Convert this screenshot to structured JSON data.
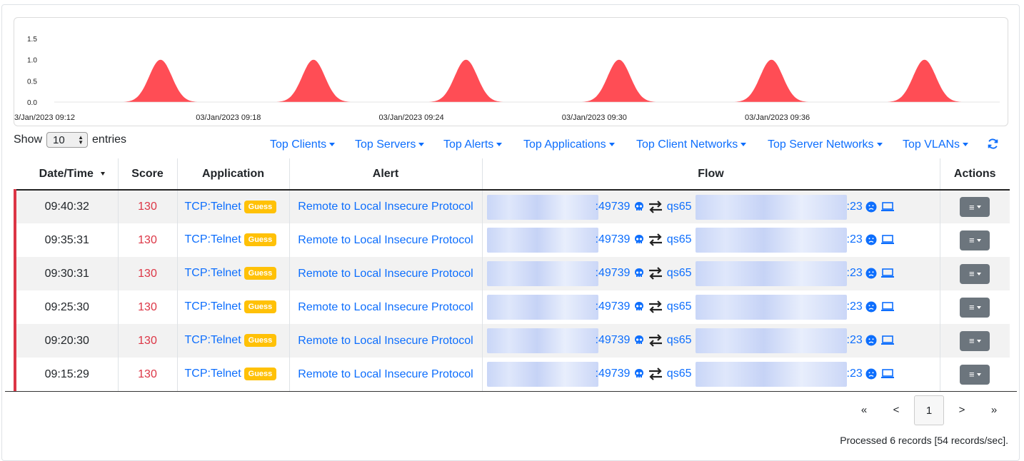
{
  "chart_data": {
    "type": "area",
    "color": "#ff4d55",
    "y_ticks": [
      "1.5",
      "1.0",
      "0.5",
      "0.0"
    ],
    "ylim": [
      0,
      1.5
    ],
    "x_ticks": [
      "3/Jan/2023 09:12",
      "03/Jan/2023 09:18",
      "03/Jan/2023 09:24",
      "03/Jan/2023 09:30",
      "03/Jan/2023 09:36"
    ],
    "x_range": [
      "09:12",
      "09:43"
    ],
    "peaks": [
      {
        "x": "09:15:29",
        "y": 1
      },
      {
        "x": "09:20:30",
        "y": 1
      },
      {
        "x": "09:25:30",
        "y": 1
      },
      {
        "x": "09:30:31",
        "y": 1
      },
      {
        "x": "09:35:31",
        "y": 1
      },
      {
        "x": "09:40:32",
        "y": 1
      }
    ]
  },
  "length_control": {
    "show_label": "Show",
    "value": "10",
    "entries_label": "entries"
  },
  "filters": [
    {
      "label": "Top Clients"
    },
    {
      "label": "Top Servers"
    },
    {
      "label": "Top Alerts"
    },
    {
      "label": "Top Applications"
    },
    {
      "label": "Top Client Networks"
    },
    {
      "label": "Top Server Networks"
    },
    {
      "label": "Top VLANs"
    }
  ],
  "columns": {
    "datetime": "Date/Time",
    "score": "Score",
    "application": "Application",
    "alert": "Alert",
    "flow": "Flow",
    "actions": "Actions"
  },
  "rows": [
    {
      "time": "09:40:32",
      "score": "130",
      "app": "TCP:Telnet",
      "badge": "Guess",
      "alert": "Remote to Local Insecure Protocol",
      "cli_port": ":49739",
      "srv_name": "qs65",
      "srv_port": ":23"
    },
    {
      "time": "09:35:31",
      "score": "130",
      "app": "TCP:Telnet",
      "badge": "Guess",
      "alert": "Remote to Local Insecure Protocol",
      "cli_port": ":49739",
      "srv_name": "qs65",
      "srv_port": ":23"
    },
    {
      "time": "09:30:31",
      "score": "130",
      "app": "TCP:Telnet",
      "badge": "Guess",
      "alert": "Remote to Local Insecure Protocol",
      "cli_port": ":49739",
      "srv_name": "qs65",
      "srv_port": ":23"
    },
    {
      "time": "09:25:30",
      "score": "130",
      "app": "TCP:Telnet",
      "badge": "Guess",
      "alert": "Remote to Local Insecure Protocol",
      "cli_port": ":49739",
      "srv_name": "qs65",
      "srv_port": ":23"
    },
    {
      "time": "09:20:30",
      "score": "130",
      "app": "TCP:Telnet",
      "badge": "Guess",
      "alert": "Remote to Local Insecure Protocol",
      "cli_port": ":49739",
      "srv_name": "qs65",
      "srv_port": ":23"
    },
    {
      "time": "09:15:29",
      "score": "130",
      "app": "TCP:Telnet",
      "badge": "Guess",
      "alert": "Remote to Local Insecure Protocol",
      "cli_port": ":49739",
      "srv_name": "qs65",
      "srv_port": ":23"
    }
  ],
  "pagination": {
    "first": "«",
    "prev": "<",
    "current": "1",
    "next": ">",
    "last": "»"
  },
  "footer": {
    "processed": "Processed 6 records [54 records/sec]."
  },
  "icons": {
    "refresh": "refresh-icon",
    "skull": "skull-icon",
    "swap": "exchange-icon",
    "sad": "sad-face-icon",
    "laptop": "laptop-icon",
    "menu": "menu-icon"
  },
  "colors": {
    "accent": "#0d6efd",
    "danger": "#dc3545",
    "warning": "#ffc107",
    "chart": "#ff4d55"
  }
}
